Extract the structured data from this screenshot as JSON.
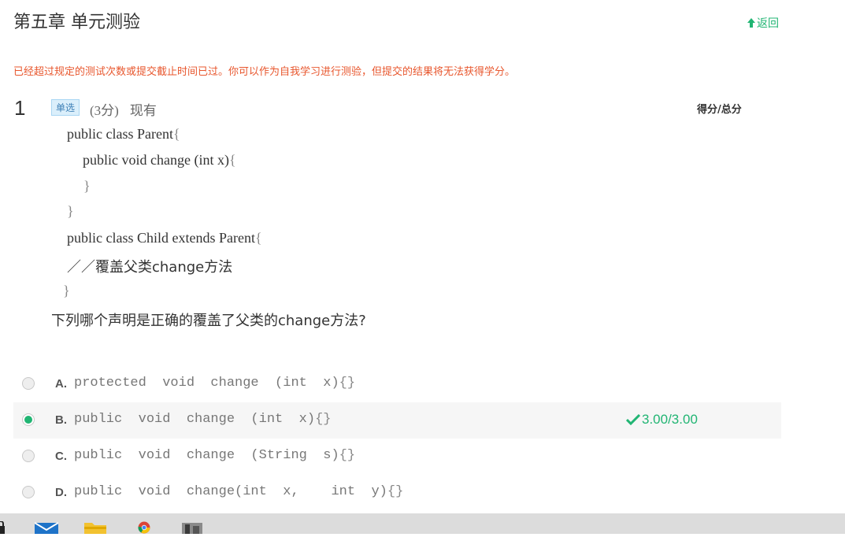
{
  "page": {
    "title": "第五章 单元测验",
    "back_label": "返回",
    "warning": "已经超过规定的测试次数或提交截止时间已过。你可以作为自我学习进行测验，但提交的结果将无法获得学分。"
  },
  "question": {
    "number": "1",
    "type": "单选",
    "points": "(3分)",
    "status": "现有",
    "score_header": "得分/总分",
    "code_lines": [
      "public class Parent",
      "public void change (int x)",
      "public class Child extends Parent",
      "／／覆盖父类change方法"
    ],
    "braces": {
      "open": "{",
      "close": "}"
    },
    "prompt": "下列哪个声明是正确的覆盖了父类的change方法?",
    "options": [
      {
        "letter": "A.",
        "text": "protected  void  change  (int  x)",
        "tail": "{}",
        "selected": false,
        "result": ""
      },
      {
        "letter": "B.",
        "text": "public  void  change  (int  x)",
        "tail": "{}",
        "selected": true,
        "result": "3.00/3.00"
      },
      {
        "letter": "C.",
        "text": "public  void  change  (String  s)",
        "tail": "{}",
        "selected": false,
        "result": ""
      },
      {
        "letter": "D.",
        "text": "public  void  change(int  x,    int  y)",
        "tail": "{}",
        "selected": false,
        "result": ""
      }
    ]
  },
  "colors": {
    "accent_green": "#21b573",
    "warning_red": "#e8572e",
    "type_badge_bg": "#dbeffb"
  },
  "taskbar": {
    "icons": [
      "lock-icon",
      "mail-icon",
      "folder-icon",
      "chrome-icon",
      "photo-app-icon"
    ]
  }
}
